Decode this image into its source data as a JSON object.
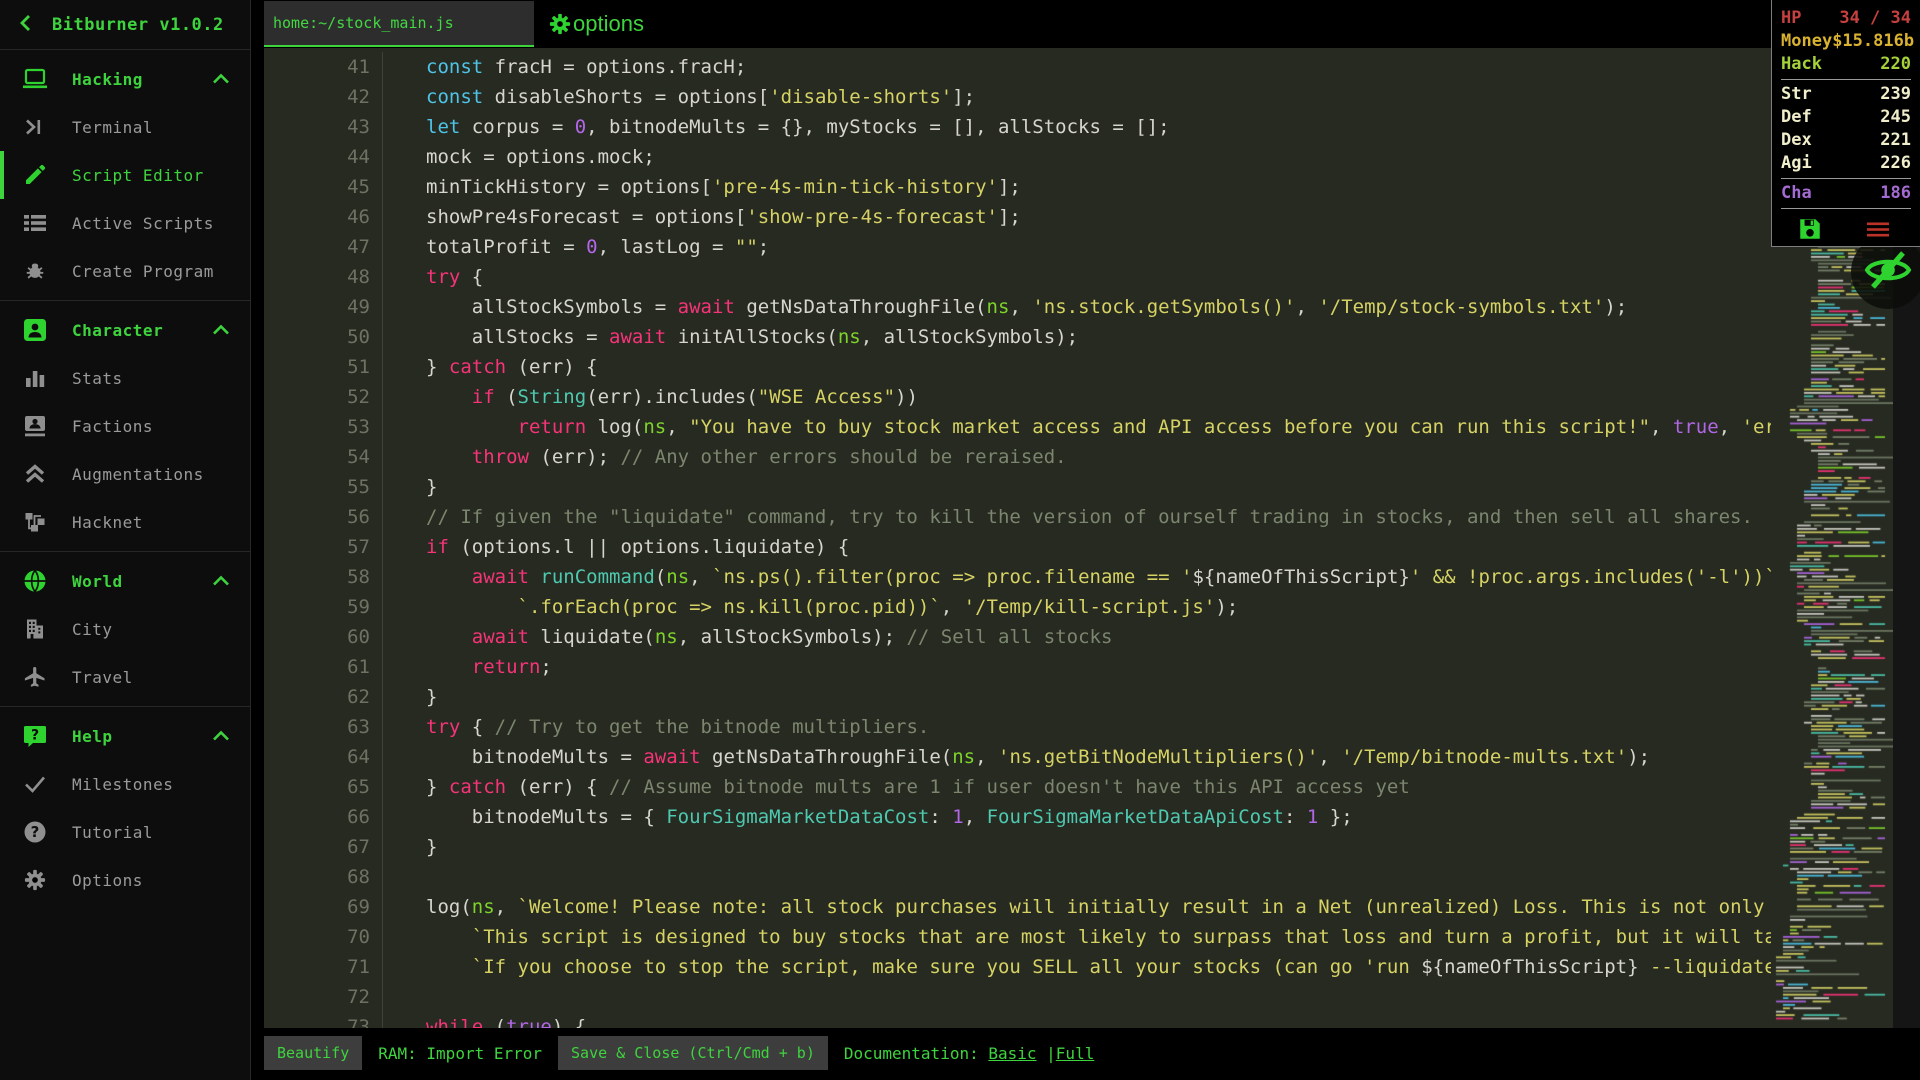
{
  "app": {
    "title": "Bitburner v1.0.2",
    "back_icon": "chevron-left-icon"
  },
  "colors": {
    "accent_green": "#3ed43e",
    "hp_red": "#c5403f",
    "money_gold": "#d9b230",
    "hack_green": "#a5d23a",
    "physical_beige": "#f1eecb",
    "charisma_purple": "#a46bd2",
    "editor_background": "#262a21"
  },
  "sidebar": {
    "sections": [
      {
        "label": "Hacking",
        "icon": "laptop-icon",
        "expanded": true,
        "items": [
          {
            "label": "Terminal",
            "icon": "terminal-icon"
          },
          {
            "label": "Script Editor",
            "icon": "pencil-icon",
            "active": true
          },
          {
            "label": "Active Scripts",
            "icon": "list-icon"
          },
          {
            "label": "Create Program",
            "icon": "bug-icon"
          }
        ]
      },
      {
        "label": "Character",
        "icon": "person-badge-icon",
        "expanded": true,
        "items": [
          {
            "label": "Stats",
            "icon": "bar-chart-icon"
          },
          {
            "label": "Factions",
            "icon": "contact-card-icon"
          },
          {
            "label": "Augmentations",
            "icon": "double-chevron-up-icon"
          },
          {
            "label": "Hacknet",
            "icon": "network-nodes-icon"
          }
        ]
      },
      {
        "label": "World",
        "icon": "globe-icon",
        "expanded": true,
        "items": [
          {
            "label": "City",
            "icon": "building-icon"
          },
          {
            "label": "Travel",
            "icon": "airplane-icon"
          }
        ]
      },
      {
        "label": "Help",
        "icon": "help-bubble-icon",
        "expanded": true,
        "items": [
          {
            "label": "Milestones",
            "icon": "check-icon"
          },
          {
            "label": "Tutorial",
            "icon": "question-circle-icon"
          },
          {
            "label": "Options",
            "icon": "gear-icon"
          }
        ]
      }
    ]
  },
  "editor": {
    "tab_label": "home:~/stock_main.js",
    "options_label": "options",
    "lines": [
      {
        "n": 41,
        "ind": 0,
        "tok": [
          [
            "k",
            "const"
          ],
          [
            "p",
            " fracH = options.fracH;"
          ]
        ]
      },
      {
        "n": 42,
        "ind": 0,
        "tok": [
          [
            "k",
            "const"
          ],
          [
            "p",
            " disableShorts = options["
          ],
          [
            "s",
            "'disable-shorts'"
          ],
          [
            "p",
            "];"
          ]
        ]
      },
      {
        "n": 43,
        "ind": 0,
        "tok": [
          [
            "k",
            "let"
          ],
          [
            "p",
            " corpus = "
          ],
          [
            "num",
            "0"
          ],
          [
            "p",
            ", bitnodeMults = {}, myStocks = [], allStocks = [];"
          ]
        ]
      },
      {
        "n": 44,
        "ind": 0,
        "tok": [
          [
            "p",
            "mock = options.mock;"
          ]
        ]
      },
      {
        "n": 45,
        "ind": 0,
        "tok": [
          [
            "p",
            "minTickHistory = options["
          ],
          [
            "s",
            "'pre-4s-min-tick-history'"
          ],
          [
            "p",
            "];"
          ]
        ]
      },
      {
        "n": 46,
        "ind": 0,
        "tok": [
          [
            "p",
            "showPre4sForecast = options["
          ],
          [
            "s",
            "'show-pre-4s-forecast'"
          ],
          [
            "p",
            "];"
          ]
        ]
      },
      {
        "n": 47,
        "ind": 0,
        "tok": [
          [
            "p",
            "totalProfit = "
          ],
          [
            "num",
            "0"
          ],
          [
            "p",
            ", lastLog = "
          ],
          [
            "s",
            "\"\""
          ],
          [
            "p",
            ";"
          ]
        ]
      },
      {
        "n": 48,
        "ind": 0,
        "tok": [
          [
            "c",
            "try"
          ],
          [
            "p",
            " {"
          ]
        ]
      },
      {
        "n": 49,
        "ind": 1,
        "tok": [
          [
            "p",
            "allStockSymbols = "
          ],
          [
            "c",
            "await"
          ],
          [
            "p",
            " getNsDataThroughFile("
          ],
          [
            "n",
            "ns"
          ],
          [
            "p",
            ", "
          ],
          [
            "s",
            "'ns.stock.getSymbols()'"
          ],
          [
            "p",
            ", "
          ],
          [
            "s",
            "'/Temp/stock-symbols.txt'"
          ],
          [
            "p",
            ");"
          ]
        ]
      },
      {
        "n": 50,
        "ind": 1,
        "tok": [
          [
            "p",
            "allStocks = "
          ],
          [
            "c",
            "await"
          ],
          [
            "p",
            " initAllStocks("
          ],
          [
            "n",
            "ns"
          ],
          [
            "p",
            ", allStockSymbols);"
          ]
        ]
      },
      {
        "n": 51,
        "ind": 0,
        "tok": [
          [
            "p",
            "} "
          ],
          [
            "c",
            "catch"
          ],
          [
            "p",
            " (err) {"
          ]
        ]
      },
      {
        "n": 52,
        "ind": 1,
        "tok": [
          [
            "c",
            "if"
          ],
          [
            "p",
            " ("
          ],
          [
            "t",
            "String"
          ],
          [
            "p",
            "(err).includes("
          ],
          [
            "s",
            "\"WSE Access\""
          ],
          [
            "p",
            "))"
          ]
        ]
      },
      {
        "n": 53,
        "ind": 2,
        "tok": [
          [
            "c",
            "return"
          ],
          [
            "p",
            " log("
          ],
          [
            "n",
            "ns"
          ],
          [
            "p",
            ", "
          ],
          [
            "s",
            "\"You have to buy stock market access and API access before you can run this script!\""
          ],
          [
            "p",
            ", "
          ],
          [
            "num",
            "true"
          ],
          [
            "p",
            ", "
          ],
          [
            "s",
            "'error'"
          ],
          [
            "p",
            ");"
          ]
        ]
      },
      {
        "n": 54,
        "ind": 1,
        "tok": [
          [
            "c",
            "throw"
          ],
          [
            "p",
            " (err); "
          ],
          [
            "com",
            "// Any other errors should be reraised."
          ]
        ]
      },
      {
        "n": 55,
        "ind": 0,
        "tok": [
          [
            "p",
            "}"
          ]
        ]
      },
      {
        "n": 56,
        "ind": 0,
        "tok": [
          [
            "com",
            "// If given the \"liquidate\" command, try to kill the version of ourself trading in stocks, and then sell all shares."
          ]
        ]
      },
      {
        "n": 57,
        "ind": 0,
        "tok": [
          [
            "c",
            "if"
          ],
          [
            "p",
            " (options.l || options.liquidate) {"
          ]
        ]
      },
      {
        "n": 58,
        "ind": 1,
        "tok": [
          [
            "c",
            "await"
          ],
          [
            "p",
            " "
          ],
          [
            "t",
            "runCommand"
          ],
          [
            "p",
            "("
          ],
          [
            "n",
            "ns"
          ],
          [
            "p",
            ", "
          ],
          [
            "s",
            "`ns.ps().filter(proc => proc.filename == '"
          ],
          [
            "p",
            "${nameOfThisScript}"
          ],
          [
            "s",
            "' && !proc.args.includes('-l'))`"
          ],
          [
            "p",
            " +"
          ]
        ]
      },
      {
        "n": 59,
        "ind": 2,
        "tok": [
          [
            "s",
            "`.forEach(proc => ns.kill(proc.pid))`"
          ],
          [
            "p",
            ", "
          ],
          [
            "s",
            "'/Temp/kill-script.js'"
          ],
          [
            "p",
            ");"
          ]
        ]
      },
      {
        "n": 60,
        "ind": 1,
        "tok": [
          [
            "c",
            "await"
          ],
          [
            "p",
            " liquidate("
          ],
          [
            "n",
            "ns"
          ],
          [
            "p",
            ", allStockSymbols); "
          ],
          [
            "com",
            "// Sell all stocks"
          ]
        ]
      },
      {
        "n": 61,
        "ind": 1,
        "tok": [
          [
            "c",
            "return"
          ],
          [
            "p",
            ";"
          ]
        ]
      },
      {
        "n": 62,
        "ind": 0,
        "tok": [
          [
            "p",
            "}"
          ]
        ]
      },
      {
        "n": 63,
        "ind": 0,
        "tok": [
          [
            "c",
            "try"
          ],
          [
            "p",
            " { "
          ],
          [
            "com",
            "// Try to get the bitnode multipliers."
          ]
        ]
      },
      {
        "n": 64,
        "ind": 1,
        "tok": [
          [
            "p",
            "bitnodeMults = "
          ],
          [
            "c",
            "await"
          ],
          [
            "p",
            " getNsDataThroughFile("
          ],
          [
            "n",
            "ns"
          ],
          [
            "p",
            ", "
          ],
          [
            "s",
            "'ns.getBitNodeMultipliers()'"
          ],
          [
            "p",
            ", "
          ],
          [
            "s",
            "'/Temp/bitnode-mults.txt'"
          ],
          [
            "p",
            ");"
          ]
        ]
      },
      {
        "n": 65,
        "ind": 0,
        "tok": [
          [
            "p",
            "} "
          ],
          [
            "c",
            "catch"
          ],
          [
            "p",
            " (err) { "
          ],
          [
            "com",
            "// Assume bitnode mults are 1 if user doesn't have this API access yet"
          ]
        ]
      },
      {
        "n": 66,
        "ind": 1,
        "tok": [
          [
            "p",
            "bitnodeMults = { "
          ],
          [
            "t",
            "FourSigmaMarketDataCost"
          ],
          [
            "p",
            ": "
          ],
          [
            "num",
            "1"
          ],
          [
            "p",
            ", "
          ],
          [
            "t",
            "FourSigmaMarketDataApiCost"
          ],
          [
            "p",
            ": "
          ],
          [
            "num",
            "1"
          ],
          [
            "p",
            " };"
          ]
        ]
      },
      {
        "n": 67,
        "ind": 0,
        "tok": [
          [
            "p",
            "}"
          ]
        ]
      },
      {
        "n": 68,
        "ind": 0,
        "tok": []
      },
      {
        "n": 69,
        "ind": 0,
        "tok": [
          [
            "p",
            "log("
          ],
          [
            "n",
            "ns"
          ],
          [
            "p",
            ", "
          ],
          [
            "s",
            "`Welcome! Please note: all stock purchases will initially result in a Net (unrealized) Loss. This is not only due to commission.`"
          ],
          [
            "p",
            " +"
          ]
        ]
      },
      {
        "n": 70,
        "ind": 1,
        "tok": [
          [
            "s",
            "`This script is designed to buy stocks that are most likely to surpass that loss and turn a profit, but it will take time.`"
          ],
          [
            "p",
            " +"
          ]
        ]
      },
      {
        "n": 71,
        "ind": 1,
        "tok": [
          [
            "s",
            "`If you choose to stop the script, make sure you SELL all your stocks (can go 'run "
          ],
          [
            "p",
            "${nameOfThisScript}"
          ],
          [
            "s",
            " --liquidate') to get your money back.`"
          ],
          [
            "p",
            ");"
          ]
        ]
      },
      {
        "n": 72,
        "ind": 0,
        "tok": []
      },
      {
        "n": 73,
        "ind": 0,
        "tok": [
          [
            "c",
            "while"
          ],
          [
            "p",
            " ("
          ],
          [
            "num",
            "true"
          ],
          [
            "p",
            ") {"
          ]
        ]
      }
    ]
  },
  "overview": {
    "hp": {
      "label": "HP",
      "value": "34 / 34"
    },
    "money": {
      "label": "Money",
      "value": "$15.816b"
    },
    "hack": {
      "label": "Hack",
      "value": "220"
    },
    "stats": [
      {
        "label": "Str",
        "value": "239"
      },
      {
        "label": "Def",
        "value": "245"
      },
      {
        "label": "Dex",
        "value": "221"
      },
      {
        "label": "Agi",
        "value": "226"
      }
    ],
    "cha": {
      "label": "Cha",
      "value": "186"
    }
  },
  "statusbar": {
    "beautify_label": "Beautify",
    "ram_status": "RAM: Import Error",
    "save_label": "Save & Close (Ctrl/Cmd + b)",
    "documentation_label": "Documentation: ",
    "doc_basic": "Basic",
    "doc_divider": " |",
    "doc_full": "Full"
  }
}
